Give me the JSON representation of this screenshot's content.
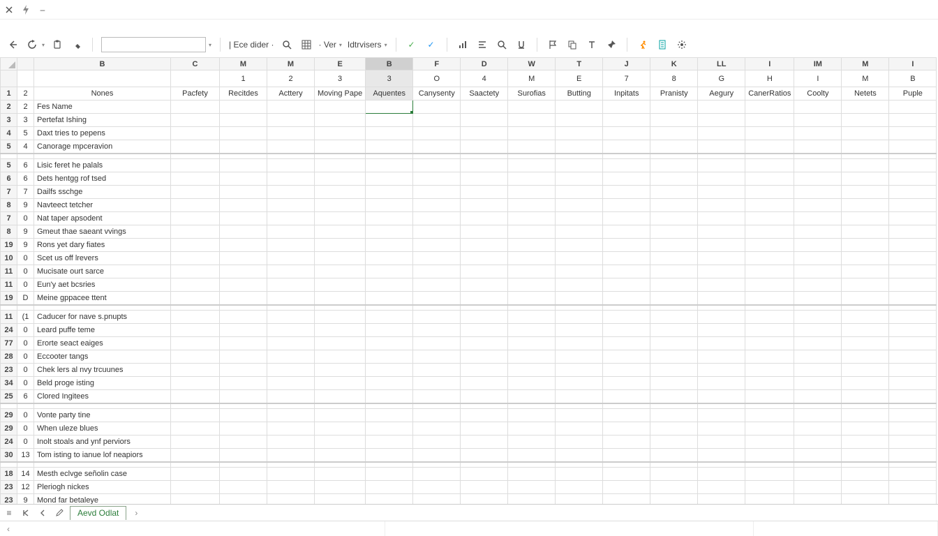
{
  "titlebar": {
    "minimize": "–"
  },
  "toolbar": {
    "namebox_value": "",
    "ece_label": "| Ece dider ·",
    "ver_label": "· Ver",
    "lat_label": "Idtrvisers"
  },
  "colLetters": [
    "",
    "",
    "B",
    "C",
    "M",
    "M",
    "E",
    "B",
    "F",
    "D",
    "W",
    "T",
    "J",
    "K",
    "LL",
    "I",
    "IM",
    "M",
    "I"
  ],
  "headerNums": [
    "",
    "",
    "",
    "",
    "1",
    "2",
    "3",
    "3",
    "O",
    "4",
    "M",
    "E",
    "7",
    "8",
    "G",
    "H",
    "I",
    "M",
    "B"
  ],
  "headerNames": [
    "",
    "",
    "Nones",
    "Pacfety",
    "Recitdes",
    "Acttery",
    "Moving Pape",
    "Aquentes",
    "Canysenty",
    "Saactety",
    "Surofias",
    "Butting",
    "Inpitats",
    "Pranisty",
    "Aegury",
    "CanerRatios",
    "Coolty",
    "Netets",
    "Puple"
  ],
  "rows": [
    {
      "rh": "1",
      "rh2": "2",
      "type": "header-row"
    },
    {
      "rh": "2",
      "rh2": "2",
      "b": "Fes Name"
    },
    {
      "rh": "3",
      "rh2": "3",
      "b": "Pertefat Ishing"
    },
    {
      "rh": "4",
      "rh2": "5",
      "b": "Daxt tries to pepens"
    },
    {
      "rh": "5",
      "rh2": "4",
      "b": "Canorage mpceravion"
    },
    {
      "gap": true
    },
    {
      "rh": "5",
      "rh2": "6",
      "b": "Lisic feret he palals"
    },
    {
      "rh": "6",
      "rh2": "6",
      "b": "Dets hentgg rof tsed"
    },
    {
      "rh": "7",
      "rh2": "7",
      "b": "Dailfs sschge"
    },
    {
      "rh": "8",
      "rh2": "9",
      "b": "Navteect tetcher"
    },
    {
      "rh": "7",
      "rh2": "0",
      "b": "Nat taper apsodent"
    },
    {
      "rh": "8",
      "rh2": "9",
      "b": "Gmeut thae saeant vvings"
    },
    {
      "rh": "19",
      "rh2": "9",
      "b": "Rons yet dary fiates"
    },
    {
      "rh": "10",
      "rh2": "0",
      "b": "Scet us off lrevers"
    },
    {
      "rh": "11",
      "rh2": "0",
      "b": "Mucisate ourt sarce"
    },
    {
      "rh": "11",
      "rh2": "0",
      "b": "Eun'y aet bcsries"
    },
    {
      "rh": "19",
      "rh2": "D",
      "b": "Meine gppacee ttent"
    },
    {
      "gap": true
    },
    {
      "rh": "11",
      "rh2": "(1",
      "b": "Caducer for nave s.pnupts"
    },
    {
      "rh": "24",
      "rh2": "0",
      "b": "Leard puffe teme"
    },
    {
      "rh": "77",
      "rh2": "0",
      "b": "Erorte seact eaiges"
    },
    {
      "rh": "28",
      "rh2": "0",
      "b": "Eccooter tangs"
    },
    {
      "rh": "23",
      "rh2": "0",
      "b": "Chek lers al nvy trcuunes"
    },
    {
      "rh": "34",
      "rh2": "0",
      "b": "Beld proge isting"
    },
    {
      "rh": "25",
      "rh2": "6",
      "b": "Clored Ingitees"
    },
    {
      "gap": true
    },
    {
      "rh": "29",
      "rh2": "0",
      "b": "Vonte party tine"
    },
    {
      "rh": "29",
      "rh2": "0",
      "b": "When uleze blues"
    },
    {
      "rh": "24",
      "rh2": "0",
      "b": "Inolt stoals and ynf perviors"
    },
    {
      "rh": "30",
      "rh2": "13",
      "b": "Tom isting to ianue lof neapiors"
    },
    {
      "gap": true
    },
    {
      "rh": "18",
      "rh2": "14",
      "b": "Mesth eclvge señolin case"
    },
    {
      "rh": "23",
      "rh2": "12",
      "b": "Pleriogh nickes"
    },
    {
      "rh": "23",
      "rh2": "9",
      "b": "Mond far betaleye"
    }
  ],
  "sheet": {
    "name": "Aevd Odlat"
  }
}
